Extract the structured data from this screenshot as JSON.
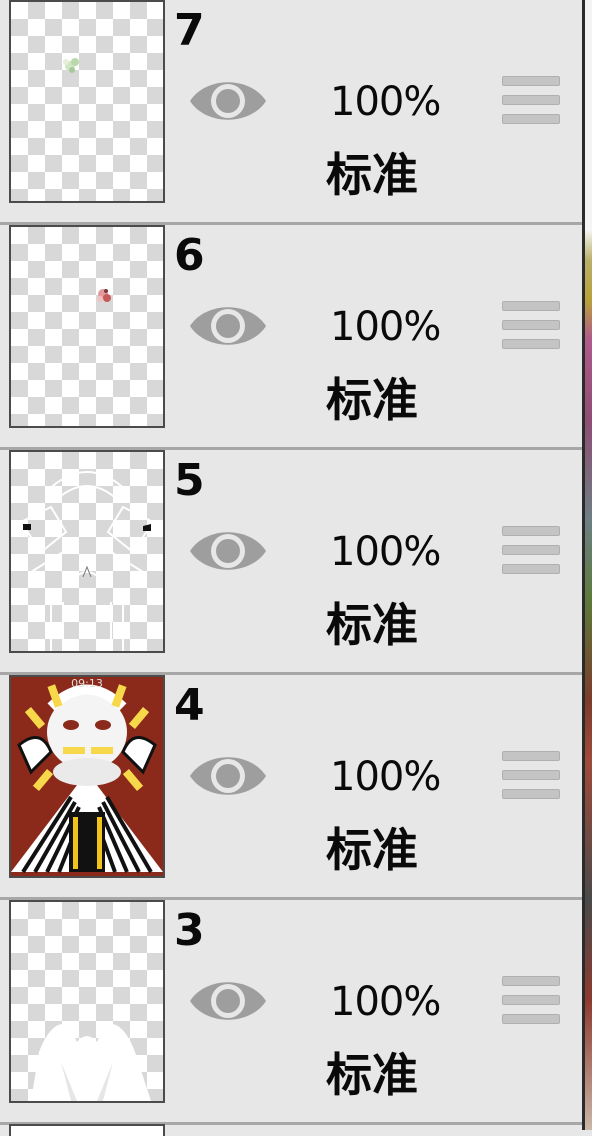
{
  "layers": [
    {
      "number": "7",
      "opacity": "100%",
      "blend_mode": "标准",
      "visible": true,
      "thumbnail": "tiny-flower"
    },
    {
      "number": "6",
      "opacity": "100%",
      "blend_mode": "标准",
      "visible": true,
      "thumbnail": "tiny-red-flower"
    },
    {
      "number": "5",
      "opacity": "100%",
      "blend_mode": "标准",
      "visible": true,
      "thumbnail": "white-lineart"
    },
    {
      "number": "4",
      "opacity": "100%",
      "blend_mode": "标准",
      "visible": true,
      "thumbnail": "red-character-art",
      "thumb_text": "09:13"
    },
    {
      "number": "3",
      "opacity": "100%",
      "blend_mode": "标准",
      "visible": true,
      "thumbnail": "white-silhouette"
    }
  ],
  "icons": {
    "visibility": "eye-icon",
    "reorder": "drag-handle-icon"
  },
  "colors": {
    "panel_bg": "#e7e7e7",
    "separator": "#a7a7a7",
    "eye": "#9e9e9e",
    "thumb_border": "#4b4b4b",
    "art_red": "#8b2a1b"
  }
}
